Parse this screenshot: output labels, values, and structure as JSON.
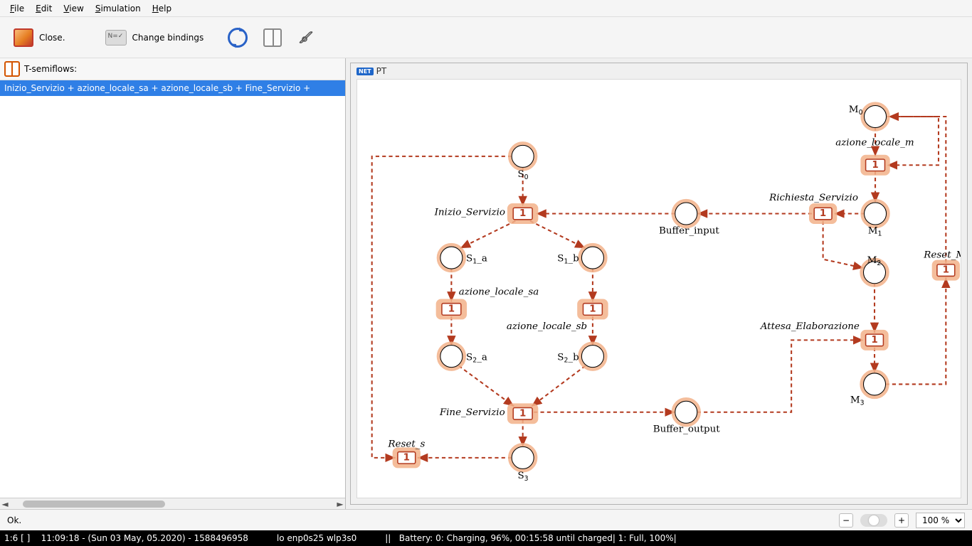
{
  "menubar": {
    "items": [
      "File",
      "Edit",
      "View",
      "Simulation",
      "Help"
    ]
  },
  "toolbar": {
    "close_label": "Close.",
    "bindings_label": "Change bindings"
  },
  "left_panel": {
    "title": "T-semiflows:",
    "items": [
      "Inizio_Servizio + azione_locale_sa + azione_locale_sb + Fine_Servizio + "
    ],
    "selected_index": 0
  },
  "canvas": {
    "badge": "NET",
    "title": "PT",
    "places": {
      "S0": "S₀",
      "S1a": "S₁_a",
      "S1b": "S₁_b",
      "S2a": "S₂_a",
      "S2b": "S₂_b",
      "S3": "S₃",
      "Bin": "Buffer_input",
      "Bout": "Buffer_output",
      "M0": "M₀",
      "M1": "M₁",
      "M2": "M₂",
      "M3": "M₃"
    },
    "transitions": {
      "inizio": {
        "label": "Inizio_Servizio",
        "weight": "1"
      },
      "az_sa": {
        "label": "azione_locale_sa",
        "weight": "1"
      },
      "az_sb": {
        "label": "azione_locale_sb",
        "weight": "1"
      },
      "fine": {
        "label": "Fine_Servizio",
        "weight": "1"
      },
      "reset_s": {
        "label": "Reset_s",
        "weight": "1"
      },
      "az_m": {
        "label": "azione_locale_m",
        "weight": "1"
      },
      "rich": {
        "label": "Richiesta_Servizio",
        "weight": "1"
      },
      "reset_m": {
        "label": "Reset_M",
        "weight": "1"
      },
      "attesa": {
        "label": "Attesa_Elaborazione",
        "weight": "1"
      }
    }
  },
  "statusbar": {
    "message": "Ok.",
    "zoom": "100 %"
  },
  "sysbar": {
    "left": "1:6 [ ]    11:09:18 - (Sun 03 May, 05.2020) - 1588496958",
    "mid": "lo enp0s25 wlp3s0",
    "right": "||   Battery: 0: Charging, 96%, 00:15:58 until charged| 1: Full, 100%|"
  }
}
